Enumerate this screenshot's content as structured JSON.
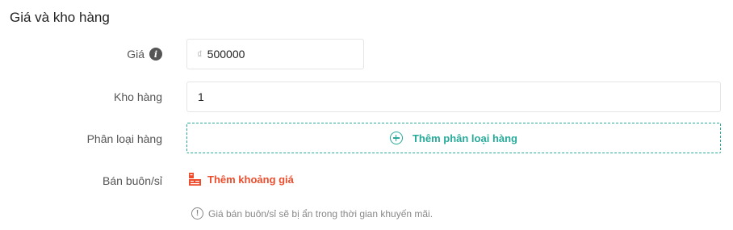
{
  "section": {
    "title": "Giá và kho hàng"
  },
  "price": {
    "label": "Giá",
    "info_icon": "info-icon",
    "currency_symbol": "₫",
    "value": "500000"
  },
  "stock": {
    "label": "Kho hàng",
    "value": "1"
  },
  "variation": {
    "label": "Phân loại hàng",
    "button_label": "Thêm phân loại hàng",
    "button_icon": "plus-circle-icon",
    "accent_color": "#26aa99"
  },
  "wholesale": {
    "label": "Bán buôn/sỉ",
    "link_label": "Thêm khoảng giá",
    "link_icon": "price-tier-icon",
    "accent_color": "#ee4d2d",
    "note": "Giá bán buôn/sỉ sẽ bị ẩn trong thời gian khuyến mãi.",
    "note_icon": "exclamation-circle-icon"
  }
}
